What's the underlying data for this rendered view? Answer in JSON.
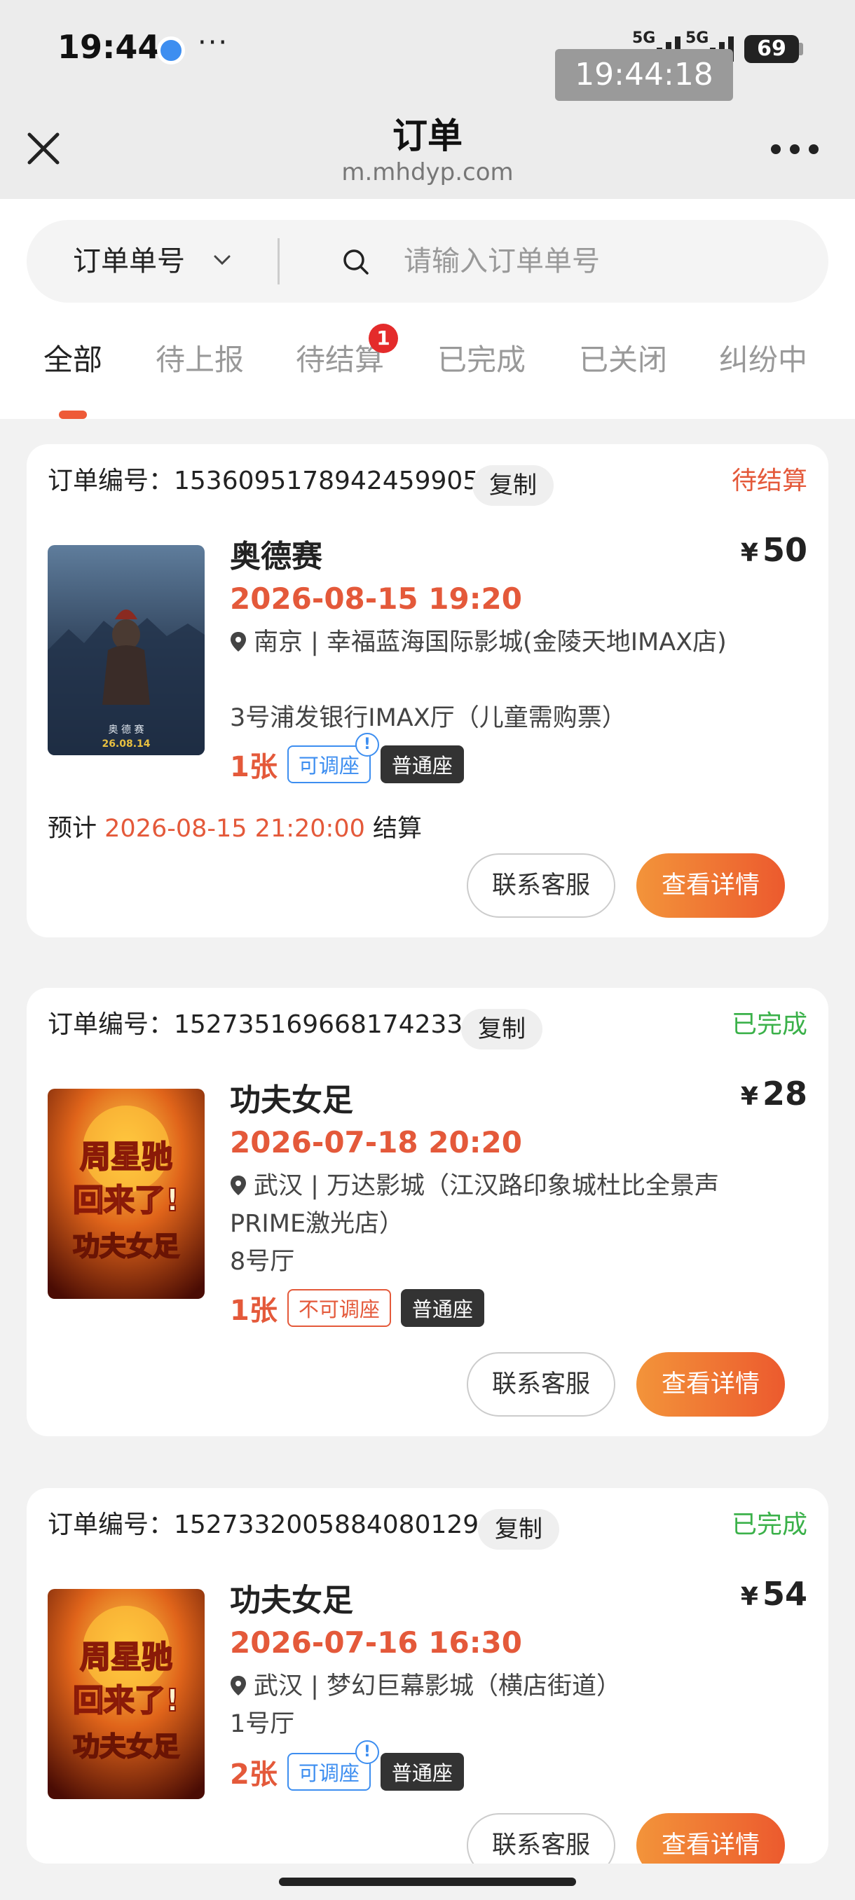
{
  "status_bar": {
    "time": "19:44",
    "dots": "···",
    "signal_labels": [
      "5G",
      "5G"
    ],
    "battery": "69",
    "clock_overlay": "19:44:18"
  },
  "navbar": {
    "title": "订单",
    "url": "m.mhdyp.com"
  },
  "search": {
    "type_label": "订单单号",
    "placeholder": "请输入订单单号"
  },
  "tabs": [
    {
      "label": "全部"
    },
    {
      "label": "待上报"
    },
    {
      "label": "待结算",
      "badge": "1"
    },
    {
      "label": "已完成"
    },
    {
      "label": "已关闭"
    },
    {
      "label": "纠纷中"
    }
  ],
  "colors": {
    "accent": "#e4593a",
    "pending": "#e4593a",
    "completed": "#3bb14a",
    "adjustable": "#3d8ef0"
  },
  "orders": [
    {
      "order_label": "订单编号：1536095178942459905",
      "copy_label": "复制",
      "status": "待结算",
      "title": "奥德赛",
      "price_symbol": "¥",
      "price": "50",
      "showtime": "2026-08-15 19:20",
      "location": "南京 | 幸福蓝海国际影城(金陵天地IMAX店)",
      "hall": "3号浦发银行IMAX厅（儿童需购票）",
      "tickets": "1张",
      "seat_tag": "可调座",
      "seat_type": "普通座",
      "settle_prefix": "预计",
      "settle_time": "2026-08-15 21:20:00",
      "settle_suffix": "结算",
      "contact_label": "联系客服",
      "detail_label": "查看详情",
      "poster_title": "奥 德 赛",
      "poster_date": "26.08.14"
    },
    {
      "order_label": "订单编号：1527351696681742336",
      "copy_label": "复制",
      "status": "已完成",
      "title": "功夫女足",
      "price_symbol": "¥",
      "price": "28",
      "showtime": "2026-07-18 20:20",
      "location": "武汉 | 万达影城（江汉路印象城杜比全景声PRIME激光店）",
      "hall": "8号厅",
      "tickets": "1张",
      "seat_tag": "不可调座",
      "seat_type": "普通座",
      "contact_label": "联系客服",
      "detail_label": "查看详情",
      "poster_line1": "周星驰",
      "poster_line2": "回来了!",
      "poster_line3": "功夫女足"
    },
    {
      "order_label": "订单编号：1527332005884080129",
      "copy_label": "复制",
      "status": "已完成",
      "title": "功夫女足",
      "price_symbol": "¥",
      "price": "54",
      "showtime": "2026-07-16 16:30",
      "location": "武汉 | 梦幻巨幕影城（横店街道）",
      "hall": "1号厅",
      "tickets": "2张",
      "seat_tag": "可调座",
      "seat_type": "普通座",
      "contact_label": "联系客服",
      "detail_label": "查看详情",
      "poster_line1": "周星驰",
      "poster_line2": "回来了!",
      "poster_line3": "功夫女足"
    }
  ]
}
